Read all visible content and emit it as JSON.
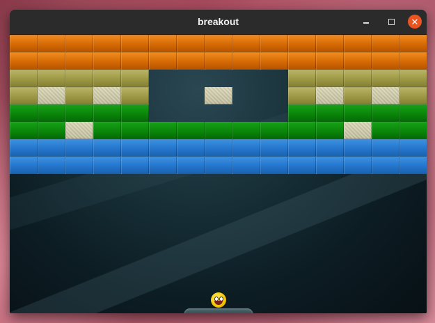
{
  "window": {
    "title": "breakout",
    "controls": [
      "minimize-icon",
      "maximize-icon",
      "close-icon"
    ]
  },
  "game": {
    "brick_colors": {
      "orange": "#d56a05",
      "olive": "#9c9845",
      "silver": "#c8c4a4",
      "green": "#0a860a",
      "blue": "#2476cc"
    },
    "grid_columns": 15,
    "rows": [
      [
        "orange",
        "orange",
        "orange",
        "orange",
        "orange",
        "orange",
        "orange",
        "orange",
        "orange",
        "orange",
        "orange",
        "orange",
        "orange",
        "orange",
        "orange"
      ],
      [
        "orange",
        "orange",
        "orange",
        "orange",
        "orange",
        "orange",
        "orange",
        "orange",
        "orange",
        "orange",
        "orange",
        "orange",
        "orange",
        "orange",
        "orange"
      ],
      [
        "olive",
        "olive",
        "olive",
        "olive",
        "olive",
        null,
        null,
        null,
        null,
        null,
        "olive",
        "olive",
        "olive",
        "olive",
        "olive"
      ],
      [
        "olive",
        "silver",
        "olive",
        "silver",
        "olive",
        null,
        null,
        "silver",
        null,
        null,
        "olive",
        "silver",
        "olive",
        "silver",
        "olive"
      ],
      [
        "green",
        "green",
        "green",
        "green",
        "green",
        null,
        null,
        null,
        null,
        null,
        "green",
        "green",
        "green",
        "green",
        "green"
      ],
      [
        "green",
        "green",
        "silver",
        "green",
        "green",
        "green",
        "green",
        "green",
        "green",
        "green",
        "green",
        "green",
        "silver",
        "green",
        "green"
      ],
      [
        "blue",
        "blue",
        "blue",
        "blue",
        "blue",
        "blue",
        "blue",
        "blue",
        "blue",
        "blue",
        "blue",
        "blue",
        "blue",
        "blue",
        "blue"
      ],
      [
        "blue",
        "blue",
        "blue",
        "blue",
        "blue",
        "blue",
        "blue",
        "blue",
        "blue",
        "blue",
        "blue",
        "blue",
        "blue",
        "blue",
        "blue"
      ]
    ],
    "ball_icon": "smiley-face-icon",
    "paddle": "paddle"
  }
}
